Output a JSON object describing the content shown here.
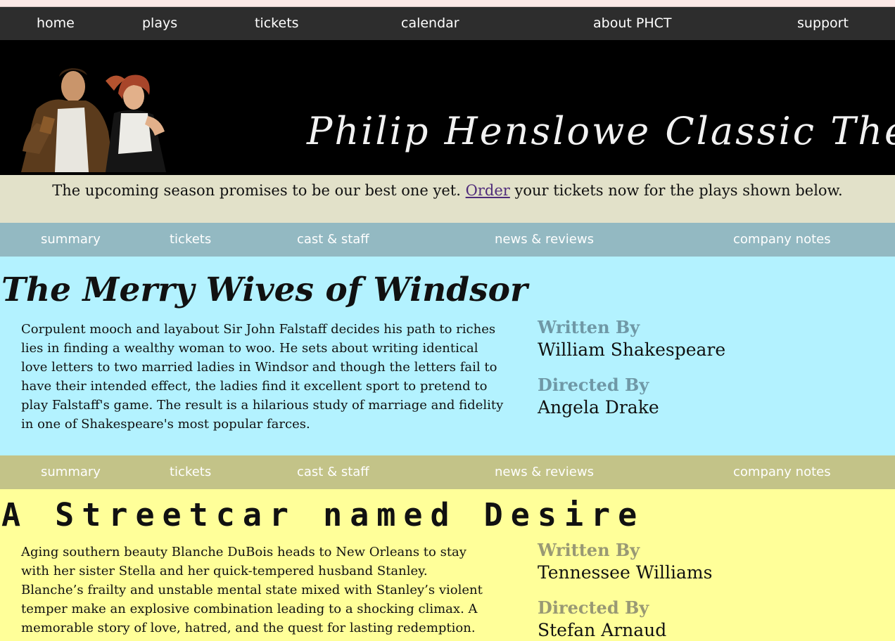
{
  "main_nav": {
    "items": [
      "home",
      "plays",
      "tickets",
      "calendar",
      "about PHCT",
      "support"
    ]
  },
  "banner": {
    "title": "Philip Henslowe Classic Theatre"
  },
  "intro": {
    "text_before": "The upcoming season promises to be our best one yet.",
    "link": "Order",
    "text_after": "your tickets now for the plays shown below."
  },
  "sub_nav": {
    "items": [
      "summary",
      "tickets",
      "cast & staff",
      "news & reviews",
      "company notes"
    ]
  },
  "plays": [
    {
      "title": "The Merry Wives of Windsor",
      "summary": "Corpulent mooch and layabout Sir John Falstaff decides his path to riches lies in finding a wealthy woman to woo. He sets about writing identical love letters to two married ladies in Windsor and though the letters fail to have their intended effect, the ladies find it excellent sport to pretend to play Falstaff's game. The result is a hilarious study of marriage and fidelity in one of Shakespeare's most popular farces.",
      "written_label": "Written By",
      "author": "William Shakespeare",
      "directed_label": "Directed By",
      "director": "Angela Drake"
    },
    {
      "title": "A Streetcar named Desire",
      "summary": "Aging southern beauty Blanche DuBois heads to New Orleans to stay with her sister Stella and her quick-tempered husband Stanley. Blanche’s frailty and unstable mental state mixed with Stanley’s violent temper make an explosive combination leading to a shocking climax. A memorable story of love, hatred, and the quest for lasting redemption.",
      "written_label": "Written By",
      "author": "Tennessee Williams",
      "directed_label": "Directed By",
      "director": "Stefan Arnaud"
    }
  ],
  "colors": {
    "nav_bg": "#2d2d2d",
    "intro_bg": "#e2e1c9",
    "teal_bar": "#93b9c2",
    "blue_section": "#b3f2ff",
    "olive_bar": "#c3c388",
    "yellow_section": "#ffff99"
  }
}
